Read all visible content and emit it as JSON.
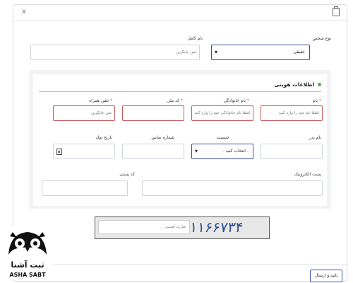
{
  "window": {
    "close_label": "x"
  },
  "top": {
    "person_type_label": "نوع شخص",
    "person_type_value": "حقیقی",
    "full_name_label": "نام کامل",
    "full_name_placeholder": "متن جایگزین"
  },
  "section": {
    "title": "اطلاعات هویتی"
  },
  "fields": {
    "first_name": {
      "label": "نام",
      "placeholder": "لطفا نام خود را وارد کنید"
    },
    "last_name": {
      "label": "نام خانوادگی",
      "placeholder": "لطفا نام خانوادگی خود را وارد کنید"
    },
    "national_code": {
      "label": "کد ملی",
      "placeholder": ""
    },
    "mobile": {
      "label": "تلفن همراه",
      "placeholder": "متن جایگزین"
    },
    "father_name": {
      "label": "نام پدر",
      "placeholder": ""
    },
    "gender": {
      "label": "جنسیت",
      "value": "- انتخاب کنید -"
    },
    "contact_number": {
      "label": "شماره تماس",
      "placeholder": ""
    },
    "birth_date": {
      "label": "تاریخ تولد",
      "placeholder": ""
    },
    "email": {
      "label": "پست الکترونیک",
      "placeholder": ""
    },
    "postal_code": {
      "label": "کد پستی",
      "placeholder": ""
    }
  },
  "captcha": {
    "code": "۱۱۶۶۷۳۴",
    "placeholder": "عبارت امنیتی"
  },
  "footer": {
    "submit_label": "تایید و ارسال"
  },
  "logo": {
    "name_fa": "ثبت آشنا",
    "name_en": "ASHA SABT"
  },
  "colors": {
    "accent": "#3a4fa3",
    "error": "#c85a5a",
    "success": "#4caf50"
  }
}
